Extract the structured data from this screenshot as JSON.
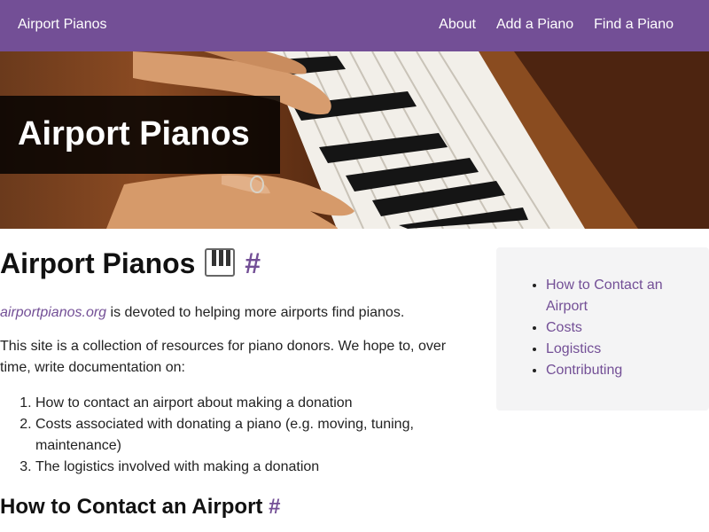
{
  "nav": {
    "brand": "Airport Pianos",
    "links": [
      "About",
      "Add a Piano",
      "Find a Piano"
    ]
  },
  "hero": {
    "title": "Airport Pianos"
  },
  "main": {
    "title": "Airport Pianos",
    "title_anchor": "#",
    "intro_link": "airportpianos.org",
    "intro_text": " is devoted to helping more airports find pianos.",
    "description": "This site is a collection of resources for piano donors. We hope to, over time, write documentation on:",
    "goals": [
      "How to contact an airport about making a donation",
      "Costs associated with donating a piano (e.g. moving, tuning, maintenance)",
      "The logistics involved with making a donation"
    ],
    "section_title": "How to Contact an Airport",
    "section_anchor": "#"
  },
  "toc": {
    "items": [
      "How to Contact an Airport",
      "Costs",
      "Logistics",
      "Contributing"
    ]
  },
  "colors": {
    "accent": "#734f96",
    "panel": "#f4f4f5"
  },
  "icons": {
    "title_icon": "piano-keyboard-icon"
  }
}
